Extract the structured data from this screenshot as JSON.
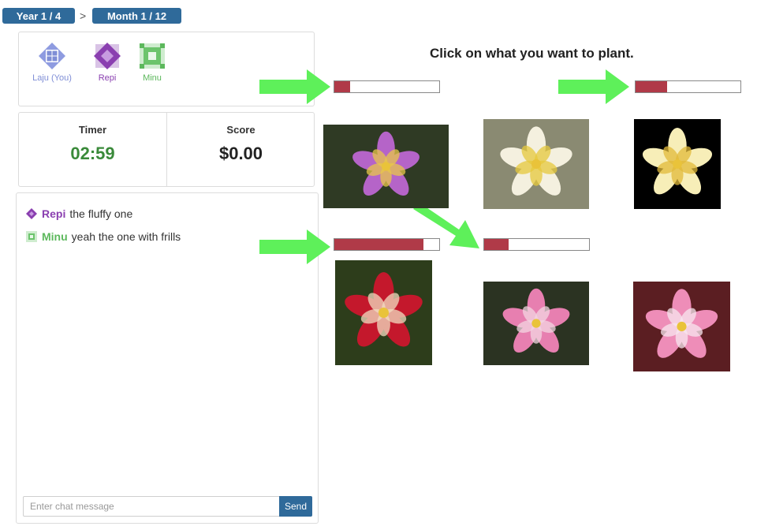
{
  "breadcrumb": {
    "year": "Year 1 / 4",
    "separator": ">",
    "month": "Month 1 / 12"
  },
  "players": [
    {
      "name": "Laju (You)",
      "color": "#7f8ed6",
      "icon": "grid-diamond-icon"
    },
    {
      "name": "Repi",
      "color": "#8a3fb0",
      "icon": "diamond-icon"
    },
    {
      "name": "Minu",
      "color": "#5cb85c",
      "icon": "square-frill-icon"
    }
  ],
  "stats": {
    "timer_label": "Timer",
    "timer_value": "02:59",
    "score_label": "Score",
    "score_value": "$0.00"
  },
  "chat": {
    "messages": [
      {
        "sender": "Repi",
        "text": "the fluffy one",
        "color": "#8a3fb0",
        "icon": "diamond-icon"
      },
      {
        "sender": "Minu",
        "text": "yeah the one with frills",
        "color": "#5cb85c",
        "icon": "square-frill-icon"
      }
    ],
    "placeholder": "Enter chat message",
    "send_label": "Send"
  },
  "instruction": "Click on what you want to plant.",
  "flowers": [
    {
      "name": "purple columbine",
      "bar_level": 0.15,
      "has_arrow": true,
      "background": "#2f3a24",
      "petal": "#b564c8",
      "center": "#e8c74a"
    },
    {
      "name": "white columbine",
      "bar_level": null,
      "has_arrow": true,
      "background": "#8a8a72",
      "petal": "#f4f0df",
      "center": "#e6c83c"
    },
    {
      "name": "yellow columbine",
      "bar_level": 0.3,
      "has_arrow": true,
      "background": "#000000",
      "petal": "#f7eeb8",
      "center": "#e2b93a"
    },
    {
      "name": "red columbine",
      "bar_level": 0.85,
      "has_arrow": true,
      "background": "#2d3d1b",
      "petal": "#c4182c",
      "center": "#f1dcc0"
    },
    {
      "name": "pink columbine",
      "bar_level": 0.23,
      "has_arrow": false,
      "background": "#2b3322",
      "petal": "#e77fb0",
      "center": "#f3d6e2"
    },
    {
      "name": "pink-red columbine",
      "bar_level": null,
      "has_arrow": false,
      "background": "#5b1e22",
      "petal": "#ee8db8",
      "center": "#f7e7ef"
    }
  ],
  "colors": {
    "accent": "#2f6a9a",
    "bar_fill": "#b03a48",
    "arrow": "#5ef05a",
    "timer": "#3a8a3a"
  }
}
